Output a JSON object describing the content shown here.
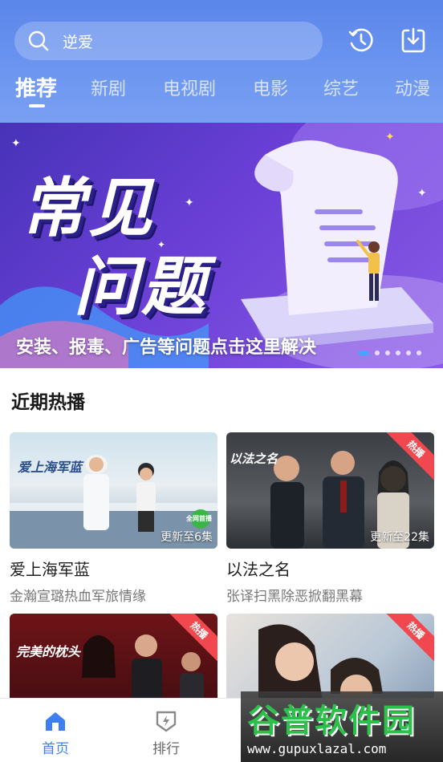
{
  "header": {
    "search_value": "逆爱",
    "search_icon": "search-icon",
    "history_icon": "history-icon",
    "download_icon": "download-icon"
  },
  "tabs": [
    {
      "label": "推荐",
      "active": true
    },
    {
      "label": "新剧",
      "active": false
    },
    {
      "label": "电视剧",
      "active": false
    },
    {
      "label": "电影",
      "active": false
    },
    {
      "label": "综艺",
      "active": false
    },
    {
      "label": "动漫",
      "active": false
    }
  ],
  "banner": {
    "title_line1": "常见",
    "title_line2": "问题",
    "caption": "安装、报毒、广告等问题点击这里解决",
    "dots_count": 6,
    "active_dot": 1
  },
  "section": {
    "title": "近期热播"
  },
  "cards": [
    {
      "title": "爱上海军蓝",
      "subtitle": "金瀚宣璐热血军旅情缘",
      "update": "更新至6集",
      "hot": "",
      "poster_text": "爱上海军蓝",
      "poster_badge": "全网首播"
    },
    {
      "title": "以法之名",
      "subtitle": "张译扫黑除恶掀翻黑幕",
      "update": "更新至22集",
      "hot": "热播",
      "poster_text": "以法之名",
      "poster_badge": ""
    },
    {
      "title": "",
      "subtitle": "",
      "update": "",
      "hot": "热播",
      "poster_text": "完美的枕头",
      "poster_badge": ""
    },
    {
      "title": "",
      "subtitle": "",
      "update": "",
      "hot": "热播",
      "poster_text": "",
      "poster_badge": ""
    }
  ],
  "bottom_nav": [
    {
      "label": "首页",
      "icon": "home-icon",
      "active": true
    },
    {
      "label": "排行",
      "icon": "ranking-icon",
      "active": false
    }
  ],
  "watermark": {
    "brand": "谷普软件园",
    "url": "www.gupuxlazal.com"
  },
  "colors": {
    "accent": "#3d7ff0",
    "header_top": "#5b86ea",
    "hot_badge": "#f0484e"
  }
}
